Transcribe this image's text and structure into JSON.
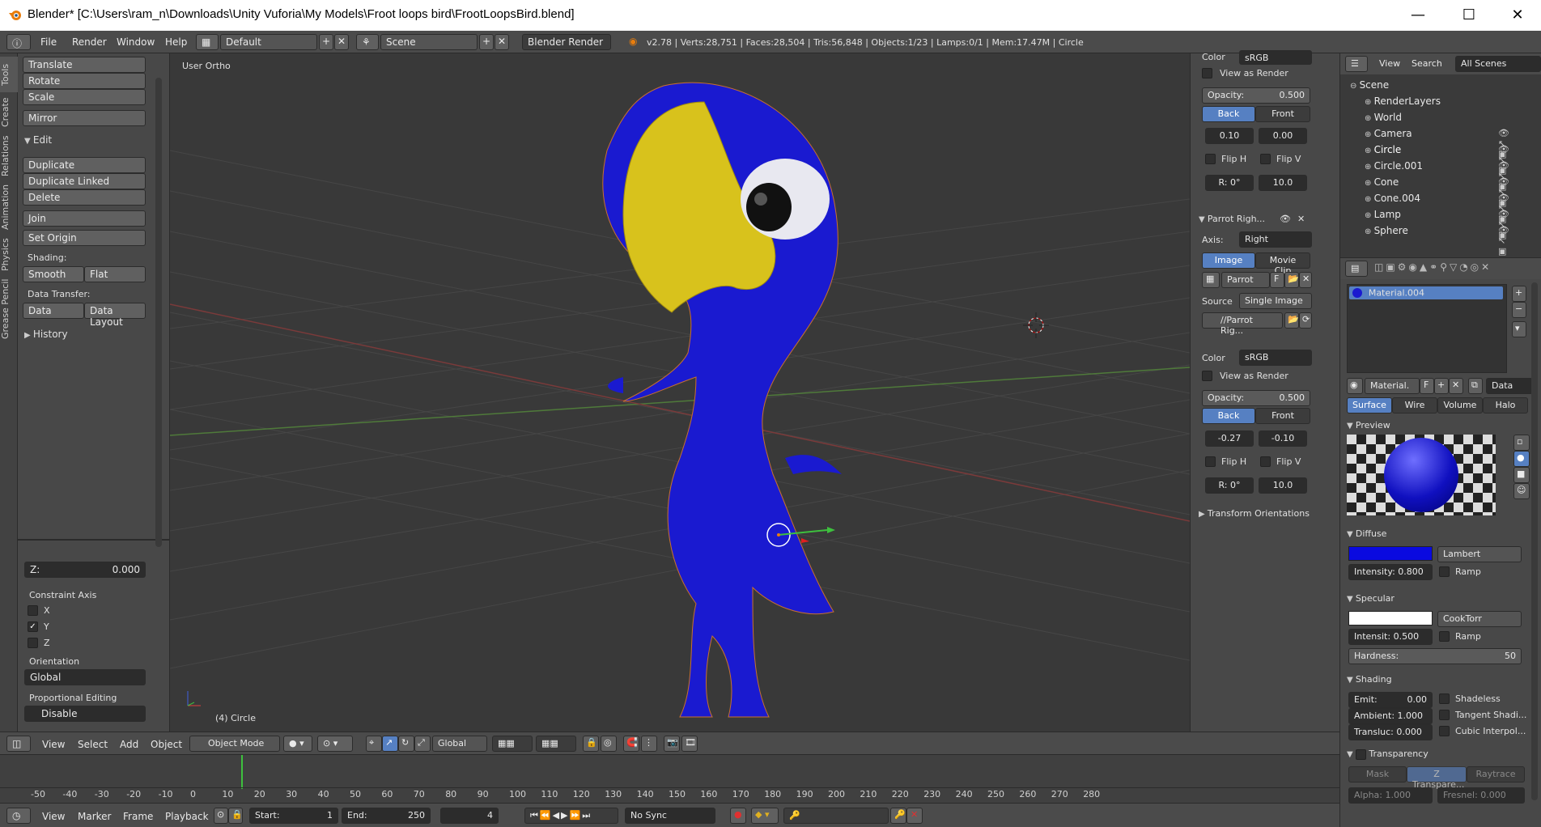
{
  "window": {
    "title": "Blender* [C:\\Users\\ram_n\\Downloads\\Unity Vuforia\\My Models\\Froot loops bird\\FrootLoopsBird.blend]",
    "minimize": "—",
    "maximize": "☐",
    "close": "✕"
  },
  "topbar": {
    "menus": [
      "File",
      "Render",
      "Window",
      "Help"
    ],
    "layout": "Default",
    "scene": "Scene",
    "engine": "Blender Render",
    "stats": "v2.78 | Verts:28,751 | Faces:28,504 | Tris:56,848 | Objects:1/23 | Lamps:0/1 | Mem:17.47M | Circle"
  },
  "lefttabs": [
    "Tools",
    "Create",
    "Relations",
    "Animation",
    "Physics",
    "Grease Pencil"
  ],
  "toolshelf": {
    "transform": [
      "Translate",
      "Rotate",
      "Scale"
    ],
    "mirror": "Mirror",
    "edit_header": "Edit",
    "edit_buttons": [
      "Duplicate",
      "Duplicate Linked",
      "Delete"
    ],
    "join": "Join",
    "set_origin": "Set Origin",
    "shading_label": "Shading:",
    "smooth": "Smooth",
    "flat": "Flat",
    "data_transfer_label": "Data Transfer:",
    "data": "Data",
    "data_layout": "Data Layout",
    "history": "History",
    "z_label": "Z:",
    "z_value": "0.000",
    "constraint_axis": "Constraint Axis",
    "axes": [
      "X",
      "Y",
      "Z"
    ],
    "orientation_label": "Orientation",
    "orientation_value": "Global",
    "proportional_label": "Proportional Editing",
    "proportional_value": "Disable"
  },
  "viewport": {
    "view_label": "User Ortho",
    "object_label": "(4) Circle",
    "colors": {
      "body": "#1a1ad0",
      "beak": "#d8c21c",
      "grid": "#4a4a4a"
    }
  },
  "npanel": {
    "bg1": {
      "color_label": "Color",
      "color_value": "sRGB",
      "view_as_render": "View as Render",
      "opacity_label": "Opacity:",
      "opacity_value": "0.500",
      "back": "Back",
      "front": "Front",
      "x": "0.10",
      "y": "0.00",
      "flip_h": "Flip H",
      "flip_v": "Flip V",
      "rot": "R: 0°",
      "size": "10.0"
    },
    "bg2": {
      "header": "Parrot Righ...",
      "axis_label": "Axis:",
      "axis_value": "Right",
      "image": "Image",
      "movie_clip": "Movie Clip",
      "image_name": "Parrot",
      "f_btn": "F",
      "source_label": "Source",
      "source_value": "Single Image",
      "path": "//Parrot Rig...",
      "color_label": "Color",
      "color_value": "sRGB",
      "view_as_render": "View as Render",
      "opacity_label": "Opacity:",
      "opacity_value": "0.500",
      "back": "Back",
      "front": "Front",
      "x": "-0.27",
      "y": "-0.10",
      "flip_h": "Flip H",
      "flip_v": "Flip V",
      "rot": "R: 0°",
      "size": "10.0"
    },
    "transform_orientations": "Transform Orientations"
  },
  "outliner": {
    "view": "View",
    "search": "Search",
    "filter": "All Scenes",
    "items": [
      {
        "name": "Scene",
        "indent": 0
      },
      {
        "name": "RenderLayers",
        "indent": 1
      },
      {
        "name": "World",
        "indent": 1
      },
      {
        "name": "Camera",
        "indent": 1
      },
      {
        "name": "Circle",
        "indent": 1
      },
      {
        "name": "Circle.001",
        "indent": 1
      },
      {
        "name": "Cone",
        "indent": 1
      },
      {
        "name": "Cone.004",
        "indent": 1
      },
      {
        "name": "Lamp",
        "indent": 1
      },
      {
        "name": "Sphere",
        "indent": 1
      }
    ]
  },
  "props": {
    "material_slot": "Material.004",
    "material_name": "Material.",
    "f_btn": "F",
    "data_btn": "Data",
    "tabs": [
      "Surface",
      "Wire",
      "Volume",
      "Halo"
    ],
    "preview": "Preview",
    "diffuse": "Diffuse",
    "diffuse_color": "#0a0ae0",
    "diffuse_shader": "Lambert",
    "intensity": "Intensity: 0.800",
    "ramp": "Ramp",
    "specular": "Specular",
    "specular_shader": "CookTorr",
    "spec_intensity": "Intensit: 0.500",
    "hardness_label": "Hardness:",
    "hardness_value": "50",
    "shading": "Shading",
    "emit": "Emit:",
    "emit_value": "0.00",
    "shadeless": "Shadeless",
    "ambient": "Ambient: 1.000",
    "tangent": "Tangent Shadi...",
    "transluc": "Transluc: 0.000",
    "cubic": "Cubic Interpol...",
    "transparency": "Transparency",
    "trans_tabs": [
      "Mask",
      "Z Transpare...",
      "Raytrace"
    ],
    "alpha": "Alpha:   1.000",
    "fresnel": "Fresnel:  0.000"
  },
  "vpheader": {
    "menus": [
      "View",
      "Select",
      "Add",
      "Object"
    ],
    "mode": "Object Mode",
    "orientation": "Global"
  },
  "timeline": {
    "ticks": [
      "-50",
      "-40",
      "-30",
      "-20",
      "-10",
      "0",
      "10",
      "20",
      "30",
      "40",
      "50",
      "60",
      "70",
      "80",
      "90",
      "100",
      "110",
      "120",
      "130",
      "140",
      "150",
      "160",
      "170",
      "180",
      "190",
      "200",
      "210",
      "220",
      "230",
      "240",
      "250",
      "260",
      "270",
      "280"
    ],
    "current_frame_position_frame": 4
  },
  "tlheader": {
    "menus": [
      "View",
      "Marker",
      "Frame",
      "Playback"
    ],
    "start_label": "Start:",
    "start_value": "1",
    "end_label": "End:",
    "end_value": "250",
    "current": "4",
    "sync": "No Sync"
  }
}
